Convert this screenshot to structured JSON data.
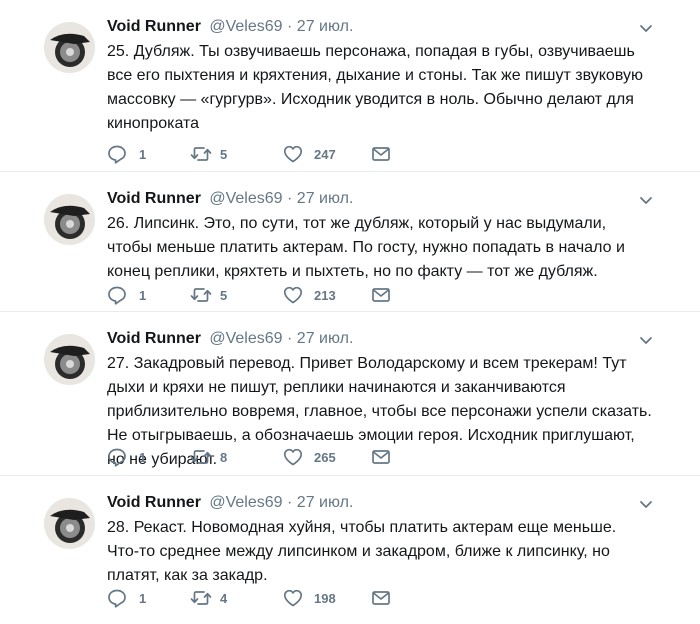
{
  "tweets": [
    {
      "name": "Void Runner",
      "handle": "@Veles69",
      "separator": "·",
      "date": "27 июл.",
      "text": "25. Дубляж. Ты озвучиваешь персонажа, попадая в губы, озвучиваешь все его пыхтения и кряхтения, дыхание и стоны. Так же пишут звуковую массовку — «гургурв». Исходник уводится в ноль. Обычно делают для кинопроката",
      "replies": "1",
      "retweets": "5",
      "likes": "247"
    },
    {
      "name": "Void Runner",
      "handle": "@Veles69",
      "separator": "·",
      "date": "27 июл.",
      "text": "26. Липсинк. Это, по сути, тот же дубляж, который у нас выдумали, чтобы меньше платить актерам. По госту, нужно попадать в начало и конец реплики, кряхтеть и пыхтеть, но по факту — тот же дубляж.",
      "replies": "1",
      "retweets": "5",
      "likes": "213"
    },
    {
      "name": "Void Runner",
      "handle": "@Veles69",
      "separator": "·",
      "date": "27 июл.",
      "text": "27. Закадровый перевод. Привет Володарскому и всем трекерам! Тут дыхи и кряхи не пишут, реплики начинаются и заканчиваются приблизительно вовремя, главное, чтобы все персонажи успели сказать. Не отыгрываешь, а обозначаешь эмоции героя. Исходник приглушают, но не убирают.",
      "replies": "1",
      "retweets": "8",
      "likes": "265"
    },
    {
      "name": "Void Runner",
      "handle": "@Veles69",
      "separator": "·",
      "date": "27 июл.",
      "text": "28. Рекаст. Новомодная хуйня, чтобы платить актерам еще меньше. Что-то среднее между липсинком и закадром, ближе к липсинку, но платят, как за закадр.",
      "replies": "1",
      "retweets": "4",
      "likes": "198"
    }
  ],
  "icons": {
    "reply": "reply-icon",
    "retweet": "retweet-icon",
    "like": "heart-icon",
    "message": "envelope-icon",
    "caret": "chevron-down-icon"
  },
  "colors": {
    "text": "#14171a",
    "secondary": "#657786",
    "divider": "#e6ecf0"
  }
}
